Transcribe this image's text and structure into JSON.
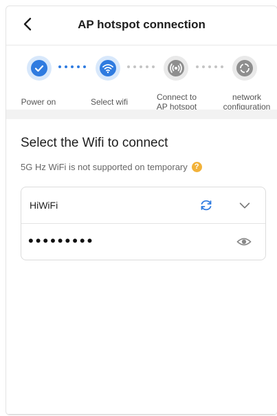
{
  "header": {
    "title": "AP hotspot connection",
    "back_icon": "chevron-left-icon"
  },
  "colors": {
    "accent": "#2f7be0",
    "accent_light": "#d8e8fb",
    "inactive": "#8e8e8e",
    "inactive_light": "#e9e9e9",
    "help": "#f2b23a"
  },
  "steps": [
    {
      "label": "Power on",
      "icon": "check-icon",
      "state": "done"
    },
    {
      "label": "Select wifi",
      "icon": "wifi-icon",
      "state": "active"
    },
    {
      "label": "Connect to\nAP hotspot",
      "icon": "hotspot-icon",
      "state": "pending"
    },
    {
      "label": "network\nconfiguration",
      "icon": "network-config-icon",
      "state": "pending"
    }
  ],
  "content": {
    "title": "Select the Wifi to connect",
    "note": "5G Hz WiFi is not supported on temporary",
    "help_icon": "question-icon"
  },
  "form": {
    "ssid_value": "HiWiFi",
    "password_value": "•••••••••",
    "refresh_icon": "refresh-icon",
    "dropdown_icon": "chevron-down-icon",
    "visibility_icon": "eye-icon"
  }
}
